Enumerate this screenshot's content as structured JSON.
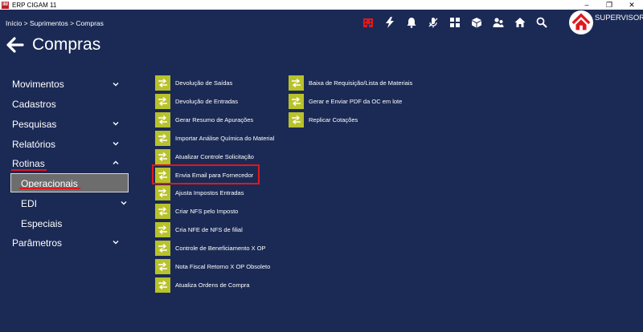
{
  "window": {
    "title": "ERP CIGAM 11",
    "logo_text": "IM",
    "buttons": [
      "–",
      "❐",
      "✕"
    ]
  },
  "breadcrumb": "Início > Suprimentos > Compras",
  "toolbar": {
    "icons": [
      "building-icon",
      "lightning-icon",
      "bell-icon",
      "microphone-off-icon",
      "grid-icon",
      "box-icon",
      "users-icon",
      "home-icon",
      "search-icon"
    ],
    "accent_color": "#e0181d"
  },
  "user": {
    "name": "SUPERVISOR"
  },
  "page": {
    "title": "Compras"
  },
  "sidebar": {
    "items": [
      {
        "label": "Movimentos",
        "expandable": true
      },
      {
        "label": "Cadastros",
        "expandable": false
      },
      {
        "label": "Pesquisas",
        "expandable": true
      },
      {
        "label": "Relatórios",
        "expandable": true
      },
      {
        "label": "Rotinas",
        "expandable": true,
        "expanded": true
      },
      {
        "label": "Parâmetros",
        "expandable": true
      }
    ],
    "sub_items": [
      {
        "label": "Operacionais",
        "selected": true
      },
      {
        "label": "EDI",
        "expandable": true
      },
      {
        "label": "Especiais"
      }
    ]
  },
  "routines": {
    "col1": [
      "Devolução  de Saídas",
      "Devolução de Entradas",
      "Gerar Resumo de Apurações",
      "Importar Análise Química do Material",
      "Atualizar Controle Solicitação",
      "Envia Email para Fornecedor",
      "Ajusta Impostos Entradas",
      "Criar NFS pelo Imposto",
      "Cria NFE de NFS de filial",
      "Controle de Beneficiamento X OP",
      "Nota Fiscal Retorno X OP Obsoleto",
      "Atualiza Ordens de Compra"
    ],
    "col2": [
      "Baixa de Requisição/Lista de Materiais",
      "Gerar e Enviar PDF da OC em lote",
      "Replicar Cotações"
    ],
    "highlighted": "Envia Email para Fornecedor",
    "icon_color": "#b8c22a"
  }
}
